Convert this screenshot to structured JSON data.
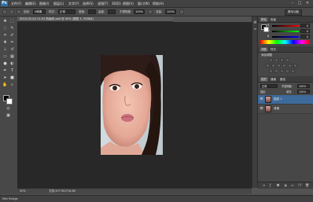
{
  "app": {
    "logo": "Ps"
  },
  "menu": {
    "items": [
      "文件(F)",
      "编辑(E)",
      "图像(I)",
      "图层(L)",
      "文字(Y)",
      "选择(S)",
      "滤镜(T)",
      "3D(D)",
      "视图(V)",
      "窗口(W)",
      "帮助(H)"
    ]
  },
  "window_controls": {
    "minimize": "–",
    "maximize": "□",
    "close": "✕"
  },
  "options": {
    "feather_label": "羽化:",
    "feather_value": "0像素",
    "style_label": "样式:",
    "style_value": "正常",
    "width_label": "宽度:",
    "height_label": "高度:",
    "opacity_label": "不透明度:",
    "opacity_value": "100%",
    "flow_label": "流量:",
    "flow_value": "100%",
    "workspace": "基本功能"
  },
  "document": {
    "tab": "2015-02-04 11:22 的画布.psd @ 50% (图层 1, RGB/8)"
  },
  "status": {
    "zoom": "50%",
    "doc_info": "文档:307.9K/716.8K"
  },
  "bottom_tab": "Mini Bridge",
  "color_panel": {
    "tabs": [
      "颜色",
      "色板"
    ],
    "sliders": [
      {
        "label": "R",
        "value": "0",
        "color": "#ff0000"
      },
      {
        "label": "G",
        "value": "0",
        "color": "#00ff00"
      },
      {
        "label": "B",
        "value": "0",
        "color": "#0000ff"
      }
    ]
  },
  "adjust_panel": {
    "tabs": [
      "调整",
      "样式"
    ],
    "title": "添加调整"
  },
  "layers_panel": {
    "tabs": [
      "图层",
      "通道",
      "路径"
    ],
    "blend_mode": "正常",
    "opacity_label": "不透明度:",
    "opacity_value": "100%",
    "lock_label": "锁定:",
    "fill_label": "填充:",
    "fill_value": "100%",
    "layers": [
      {
        "name": "图层 1",
        "selected": true
      },
      {
        "name": "背景",
        "selected": false
      }
    ]
  },
  "icons": {
    "tools": [
      "move-icon",
      "marquee-icon",
      "lasso-icon",
      "quick-select-icon",
      "crop-icon",
      "eyedropper-icon",
      "healing-icon",
      "brush-icon",
      "stamp-icon",
      "history-brush-icon",
      "eraser-icon",
      "gradient-icon",
      "blur-icon",
      "dodge-icon",
      "pen-icon",
      "type-icon",
      "path-select-icon",
      "shape-icon",
      "hand-icon",
      "zoom-icon"
    ]
  },
  "colors": {
    "accent": "#2b6fa8",
    "canvas_bg": "#282828",
    "panel_bg": "#474747"
  }
}
